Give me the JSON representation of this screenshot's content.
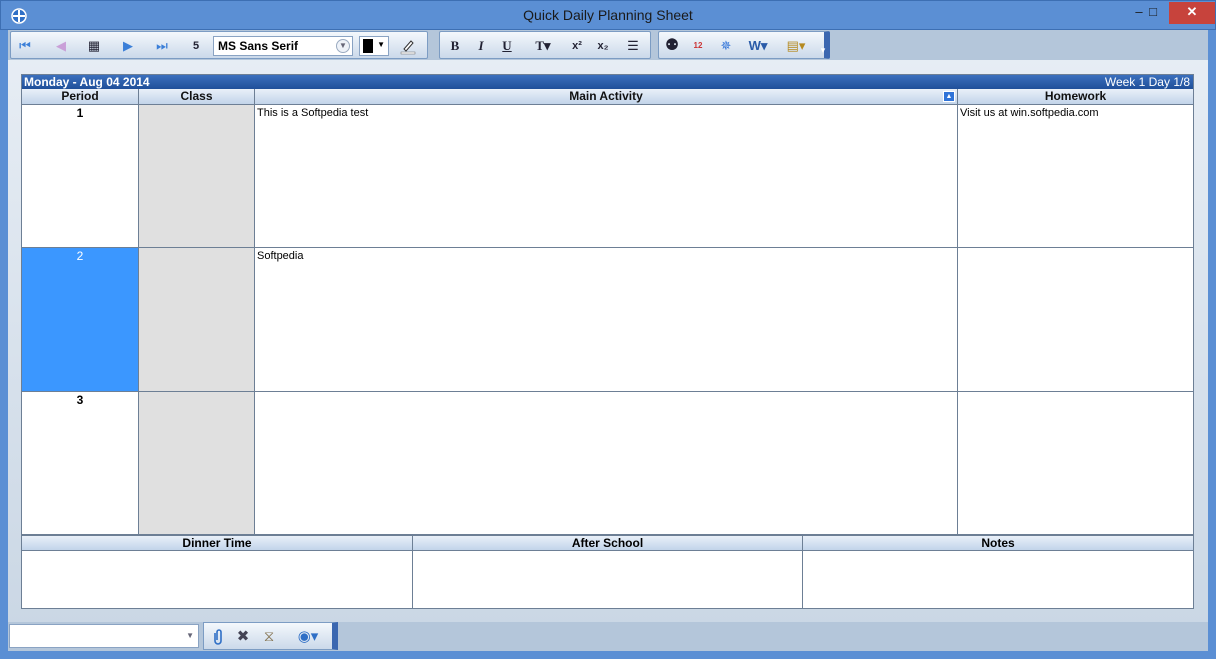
{
  "window": {
    "title": "Quick Daily Planning Sheet",
    "minimize": "–",
    "maximize": "□",
    "close": "✕"
  },
  "toolbar": {
    "nav_first": "⏮",
    "nav_prev": "◀",
    "calendar": "▦",
    "nav_next": "▶",
    "nav_last": "⏭",
    "day_num": "5",
    "font_name": "MS Sans Serif",
    "bold": "B",
    "italic": "I",
    "underline": "U",
    "text_style": "T▾",
    "superscript": "x²",
    "subscript": "x₂",
    "bullets": "☰",
    "find": "⚉",
    "date_tool": "12",
    "settings": "✵",
    "word": "W▾",
    "export": "▤▾",
    "overflow": "▾"
  },
  "colors": {
    "accent": "#5b8fd4",
    "selected_period": "#3b97ff",
    "header_bar": "#2a5ba8"
  },
  "planner": {
    "date": "Monday  -  Aug 04 2014",
    "week": "Week 1 Day 1/8",
    "columns": {
      "period": "Period",
      "class": "Class",
      "main": "Main Activity",
      "homework": "Homework"
    },
    "rows": [
      {
        "period": "1",
        "class": "",
        "main": "This is a Softpedia test",
        "homework": "Visit us at win.softpedia.com"
      },
      {
        "period": "2",
        "class": "",
        "main": "Softpedia",
        "homework": ""
      },
      {
        "period": "3",
        "class": "",
        "main": "",
        "homework": ""
      }
    ],
    "sections": {
      "dinner": "Dinner Time",
      "after_school": "After School",
      "notes": "Notes"
    }
  },
  "statusbar": {
    "combo_value": "",
    "attach": "📎",
    "delete": "✖",
    "timer": "⧖",
    "web": "◉▾"
  }
}
